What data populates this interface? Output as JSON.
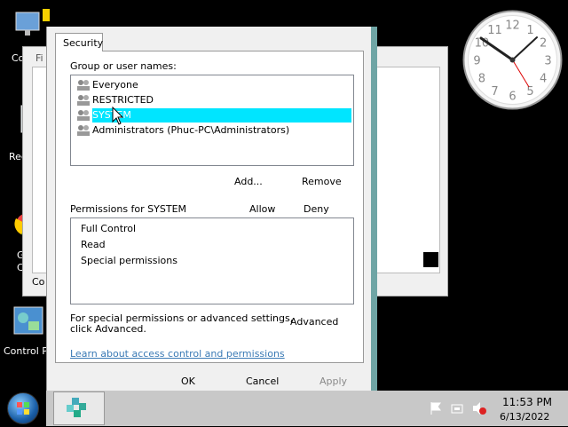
{
  "desktop": {
    "icons": [
      {
        "label": "Co"
      },
      {
        "label": "Rec"
      },
      {
        "label": "G"
      },
      {
        "label": "C"
      },
      {
        "label": "Control P"
      }
    ]
  },
  "background_window": {
    "label_fi": "Fi",
    "label_co": "Co"
  },
  "dialog": {
    "tab_label": "Security",
    "group_label": "Group or user names:",
    "users": [
      {
        "name": "Everyone"
      },
      {
        "name": "RESTRICTED"
      },
      {
        "name": "SYSTEM"
      },
      {
        "name": "Administrators (Phuc-PC\\Administrators)"
      }
    ],
    "add_button": "Add...",
    "remove_button": "Remove",
    "permissions_label": "Permissions for SYSTEM",
    "allow_header": "Allow",
    "deny_header": "Deny",
    "permissions": [
      {
        "name": "Full Control"
      },
      {
        "name": "Read"
      },
      {
        "name": "Special permissions"
      }
    ],
    "special_text_line1": "For special permissions or advanced settings,",
    "special_text_line2": "click Advanced.",
    "advanced_button": "Advanced",
    "learn_link": "Learn about access control and permissions",
    "ok_button": "OK",
    "cancel_button": "Cancel",
    "apply_button": "Apply"
  },
  "clock": {
    "numbers": [
      "12",
      "1",
      "2",
      "3",
      "4",
      "5",
      "6",
      "7",
      "8",
      "9",
      "10",
      "11"
    ]
  },
  "taskbar": {
    "time": "11:53 PM",
    "date": "6/13/2022"
  },
  "colors": {
    "selection": "#00e5ff",
    "link": "#3a7ab5",
    "taskbar": "#c8c8c8"
  }
}
